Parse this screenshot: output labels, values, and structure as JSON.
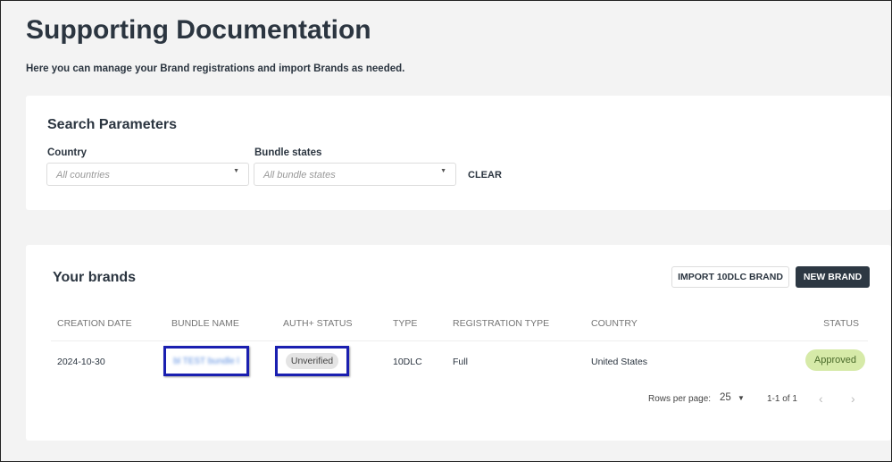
{
  "page": {
    "title": "Supporting Documentation",
    "subtitle": "Here you can manage your Brand registrations and import Brands as needed."
  },
  "search": {
    "heading": "Search Parameters",
    "country_label": "Country",
    "country_placeholder": "All countries",
    "bundle_label": "Bundle states",
    "bundle_placeholder": "All bundle states",
    "clear": "CLEAR"
  },
  "brands": {
    "heading": "Your brands",
    "import_label": "IMPORT 10DLC BRAND",
    "new_label": "NEW BRAND",
    "columns": [
      "CREATION DATE",
      "BUNDLE NAME",
      "AUTH+ STATUS",
      "TYPE",
      "REGISTRATION TYPE",
      "COUNTRY",
      "STATUS"
    ],
    "rows": [
      {
        "date": "2024-10-30",
        "bundle": "bl TEST bundle l",
        "auth": "Unverified",
        "type": "10DLC",
        "reg_type": "Full",
        "country": "United States",
        "status": "Approved"
      }
    ],
    "pagination": {
      "rows_label": "Rows per page:",
      "rows_value": "25",
      "range": "1-1 of 1"
    }
  },
  "colors": {
    "approved_bg": "#d6eaa8",
    "primary_button": "#2d3843",
    "highlight": "#1a1fb0"
  }
}
